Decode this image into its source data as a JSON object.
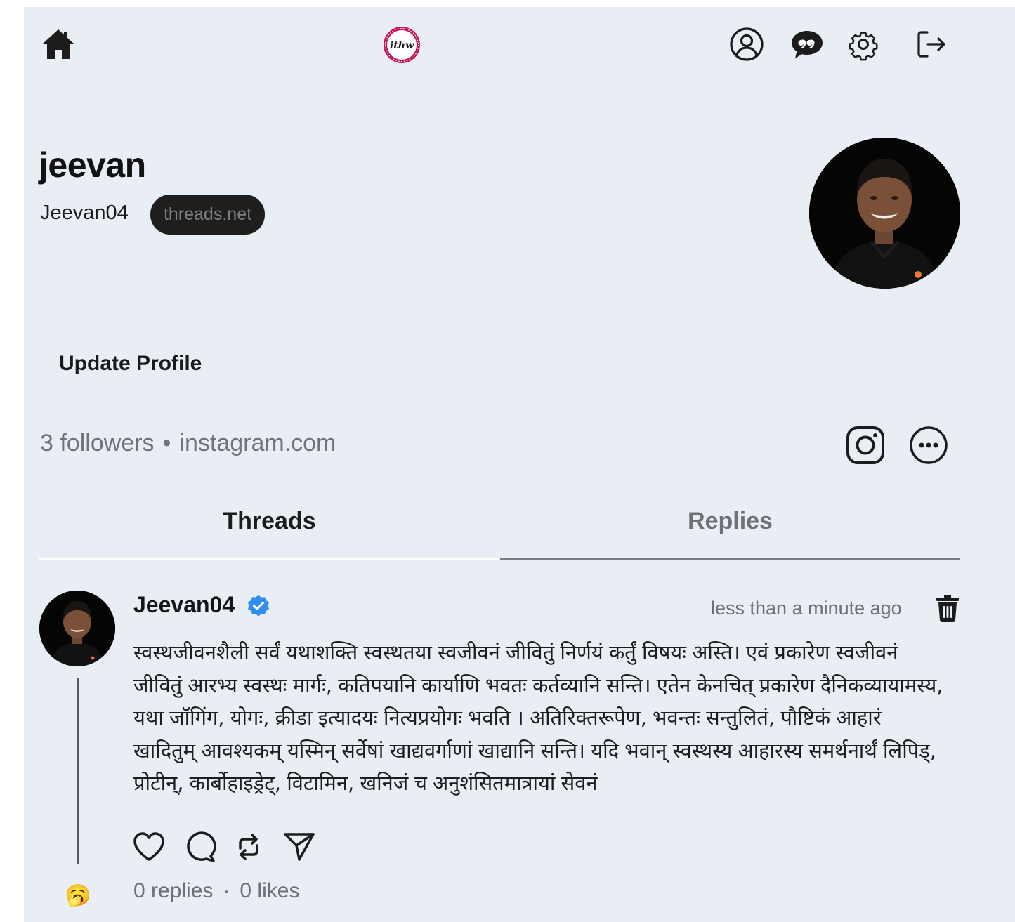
{
  "nav": {
    "icons": [
      "home-icon",
      "app-logo",
      "profile-icon",
      "chat-icon",
      "settings-icon",
      "logout-icon"
    ],
    "logo_text": "ithw"
  },
  "profile": {
    "name": "jeevan",
    "username": "Jeevan04",
    "domain_badge": "threads.net",
    "update_button": "Update Profile",
    "followers": "3 followers",
    "link": "instagram.com"
  },
  "tabs": [
    {
      "label": "Threads",
      "active": true
    },
    {
      "label": "Replies",
      "active": false
    }
  ],
  "post": {
    "username": "Jeevan04",
    "verified": true,
    "time": "less than a minute ago",
    "text": "स्वस्थजीवनशैली सर्वं यथाशक्ति स्वस्थतया स्वजीवनं जीवितुं निर्णयं कर्तुं विषयः अस्ति। एवं प्रकारेण स्वजीवनं जीवितुं आरभ्य स्वस्थः मार्गः, कतिपयानि कार्याणि भवतः कर्तव्यानि सन्ति। एतेन केनचित् प्रकारेण दैनिकव्यायामस्य, यथा जॉगिंग, योगः, क्रीडा इत्यादयः नित्यप्रयोगः भवति । अतिरिक्तरूपेण, भवन्तः सन्तुलितं, पौष्टिकं आहारं खादितुम् आवश्यकम् यस्मिन् सर्वेषां खाद्यवर्गाणां खाद्यानि सन्ति। यदि भवान् स्वस्थस्य आहारस्य समर्थनार्थं लिपिड्, प्रोटीन्, कार्बोहाइड्रेट्, विटामिन, खनिजं च अनुशंसितमात्रायां सेवनं",
    "replies": "0 replies",
    "separator": "·",
    "likes": "0 likes",
    "reply_emoji": "🥱"
  },
  "colors": {
    "background": "#e9eef4",
    "badge_bg": "#1e1e1e",
    "verified_blue": "#2f8ff0",
    "logo_ring": "#c2185b",
    "muted_text": "#6d7176"
  }
}
